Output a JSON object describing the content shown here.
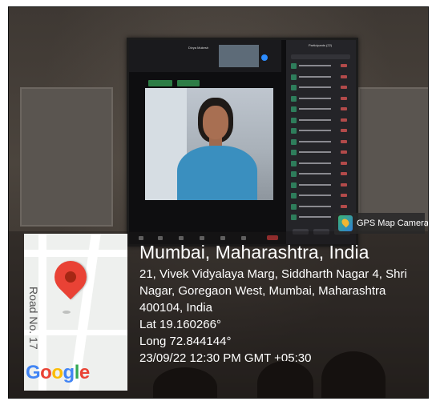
{
  "screen": {
    "self_view_name": "Divya Mukesh",
    "participants_title": "Participants (22)",
    "participant_count": 15
  },
  "gps_badge": {
    "label": "GPS Map Camera",
    "icon": "gps-map-camera-icon"
  },
  "map": {
    "road_label": "Road No. 17",
    "logo_text": "Google",
    "pin_color": "#e94235"
  },
  "location": {
    "title": "Mumbai, Maharashtra, India",
    "address": "21, Vivek Vidyalaya Marg, Siddharth Nagar 4, Shri Nagar, Goregaon West, Mumbai, Maharashtra 400104, India",
    "latitude": "Lat 19.160266°",
    "longitude": "Long 72.844144°",
    "timestamp": "23/09/22 12:30 PM GMT +05:30"
  }
}
